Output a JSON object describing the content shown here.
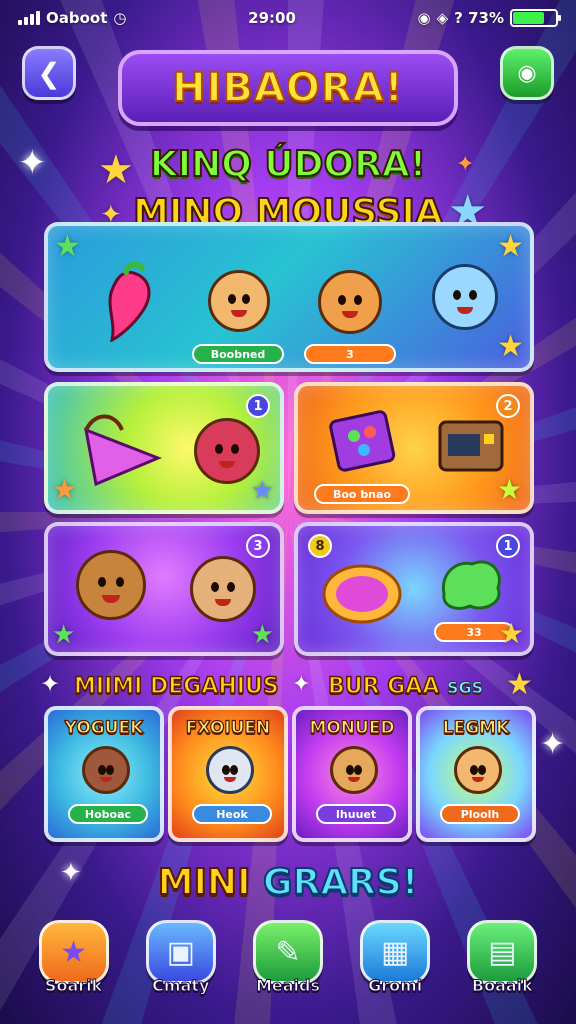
{
  "status_bar": {
    "carrier": "Oaboot",
    "time": "29:00",
    "battery_text": "? 73%",
    "battery_level": 0.73,
    "battery_color": "#3ef04a"
  },
  "header": {
    "back_icon": "chevron-left-icon",
    "menu_icon": "chat-icon",
    "title": "HIBAORA!",
    "subtitle_line1": "KINQ ÚDORA!",
    "subtitle_line2": "MINO MOUSSIA"
  },
  "hero_panel": {
    "left_pill": "Boobned",
    "right_pill": "3"
  },
  "cards": [
    {
      "badge": "1"
    },
    {
      "badge": "2",
      "pill": "Boo bnao"
    },
    {
      "badge": "3"
    },
    {
      "badge_left": "8",
      "badge": "1",
      "pill": "33"
    }
  ],
  "sections": {
    "left": "MIIMI DEGAHIUS",
    "right_main": "BUR GAA",
    "right_small": "SGS"
  },
  "mini_cards": [
    {
      "title": "YOGUEK",
      "button": "Hoboac"
    },
    {
      "title": "FXOIUEN",
      "button": "Heok"
    },
    {
      "title": "MONUED",
      "button": "Ihuuet"
    },
    {
      "title": "LEGMK",
      "button": "Ploolh"
    }
  ],
  "mini_games_title": {
    "word1": "MINI",
    "word2": "GRARS!"
  },
  "nav": [
    {
      "label": "Soarik",
      "icon": "star-icon"
    },
    {
      "label": "Cmaty",
      "icon": "card-icon"
    },
    {
      "label": "Meaids",
      "icon": "map-icon"
    },
    {
      "label": "Gromi",
      "icon": "grid-icon"
    },
    {
      "label": "Boaaik",
      "icon": "book-icon"
    }
  ]
}
